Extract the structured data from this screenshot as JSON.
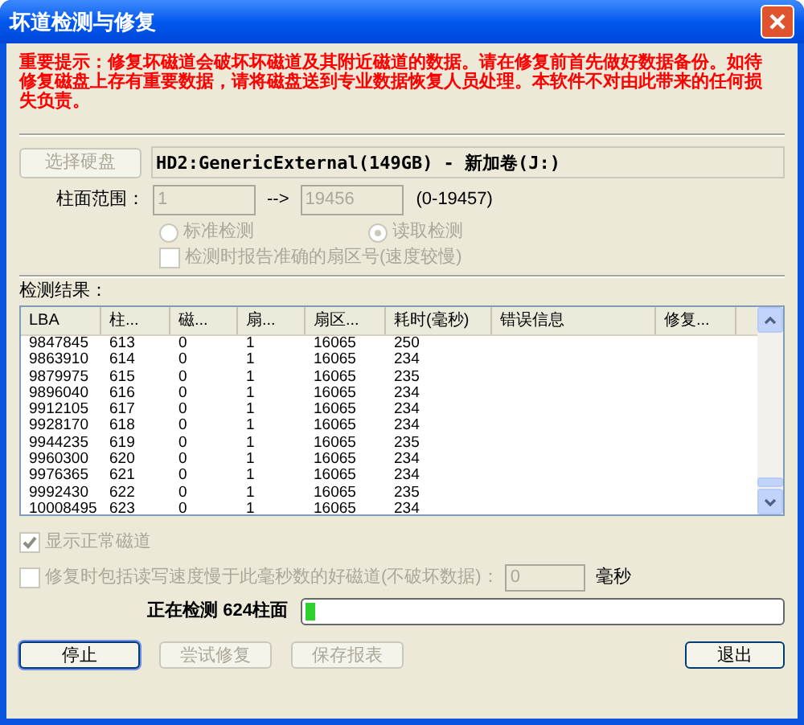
{
  "window": {
    "title": "坏道检测与修复"
  },
  "warning": "重要提示：修复坏磁道会破坏坏磁道及其附近磁道的数据。请在修复前首先做好数据备份。如待修复磁盘上存有重要数据，请将磁盘送到专业数据恢复人员处理。本软件不对由此带来的任何损失负责。",
  "select_disk_button": {
    "label": "选择硬盘",
    "disabled": true
  },
  "disk_field": {
    "value": "HD2:GenericExternal(149GB) - 新加卷(J:)"
  },
  "cylinder_range": {
    "label": "柱面范围：",
    "from": "1",
    "arrow": "-->",
    "to": "19456",
    "range": "(0-19457)",
    "disabled": true
  },
  "modes": [
    {
      "label": "标准检测",
      "selected": false,
      "disabled": true
    },
    {
      "label": "读取检测",
      "selected": true,
      "disabled": true
    }
  ],
  "report_sector": {
    "label": "检测时报告准确的扇区号(速度较慢)",
    "checked": false,
    "disabled": true
  },
  "results": {
    "label": "检测结果：",
    "columns": [
      "LBA",
      "柱...",
      "磁...",
      "扇...",
      "扇区...",
      "耗时(毫秒)",
      "错误信息",
      "修复..."
    ],
    "rows": [
      [
        "9847845",
        "613",
        "0",
        "1",
        "16065",
        "250"
      ],
      [
        "9863910",
        "614",
        "0",
        "1",
        "16065",
        "234"
      ],
      [
        "9879975",
        "615",
        "0",
        "1",
        "16065",
        "235"
      ],
      [
        "9896040",
        "616",
        "0",
        "1",
        "16065",
        "234"
      ],
      [
        "9912105",
        "617",
        "0",
        "1",
        "16065",
        "234"
      ],
      [
        "9928170",
        "618",
        "0",
        "1",
        "16065",
        "234"
      ],
      [
        "9944235",
        "619",
        "0",
        "1",
        "16065",
        "235"
      ],
      [
        "9960300",
        "620",
        "0",
        "1",
        "16065",
        "234"
      ],
      [
        "9976365",
        "621",
        "0",
        "1",
        "16065",
        "234"
      ],
      [
        "9992430",
        "622",
        "0",
        "1",
        "16065",
        "235"
      ],
      [
        "10008495",
        "623",
        "0",
        "1",
        "16065",
        "234"
      ]
    ]
  },
  "show_normal": {
    "label": "显示正常磁道",
    "checked": true,
    "disabled": true
  },
  "include_slow": {
    "label": "修复时包括读写速度慢于此毫秒数的好磁道(不破坏数据)：",
    "checked": false,
    "disabled": true,
    "value": "0",
    "unit": "毫秒"
  },
  "progress": {
    "label": "正在检测 624柱面",
    "level": 0.02
  },
  "buttons": [
    {
      "label": "停止",
      "disabled": false,
      "default": true
    },
    {
      "label": "尝试修复",
      "disabled": true,
      "default": false
    },
    {
      "label": "保存报表",
      "disabled": true,
      "default": false
    },
    {
      "label": "退出",
      "disabled": false,
      "default": false
    }
  ]
}
